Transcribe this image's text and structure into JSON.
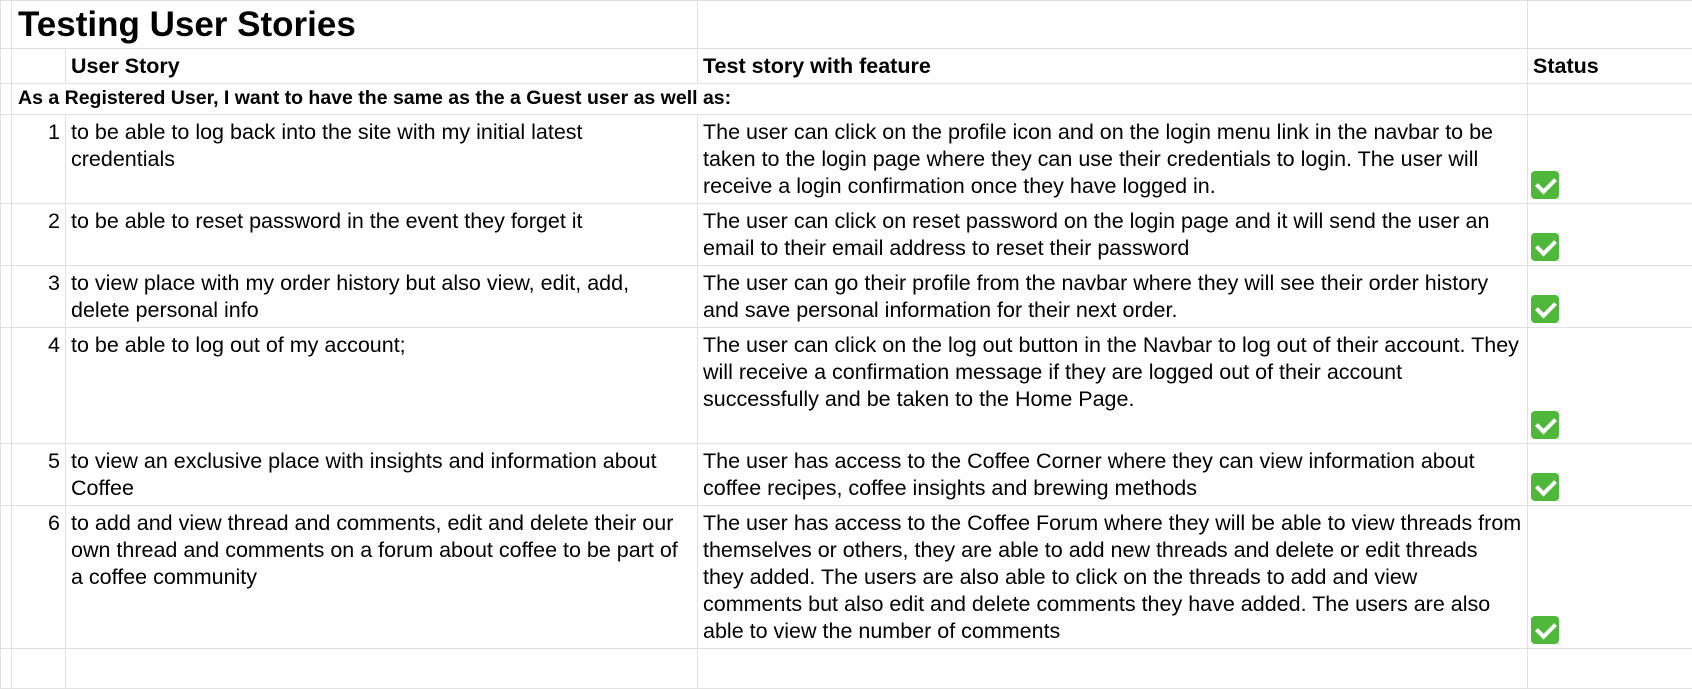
{
  "title": "Testing User Stories",
  "headers": {
    "story": "User Story",
    "test": "Test story with feature",
    "status": "Status"
  },
  "section_text": "As a Registered User, I want to have the same as the a Guest user as well as:",
  "rows": [
    {
      "num": "1",
      "story": "to be able to log back into the site with my initial latest credentials",
      "test": "The user can click on the profile icon and on the login menu link in the navbar to be taken to the login page where they can use their credentials to login. The user will receive a login confirmation once they have logged in.",
      "status_icon": "green-check-mark-icon"
    },
    {
      "num": "2",
      "story": "to be able to reset password in the event they forget it",
      "test": "The user can click on reset password on the login page and it will send the user an email to their email address to reset their password",
      "status_icon": "green-check-mark-icon"
    },
    {
      "num": "3",
      "story": "to view place with my order history but also view, edit, add, delete personal info",
      "test": "The user can go their profile from the navbar where they will see their order history and save personal information for their next order.",
      "status_icon": "green-check-mark-icon"
    },
    {
      "num": "4",
      "story": "to be able to log out of my account;",
      "test": "The user can click on the log out button in the Navbar to log out of their account. They will receive a confirmation message if they are logged out of their account successfully and be taken to the Home Page.",
      "status_icon": "green-check-mark-icon"
    },
    {
      "num": "5",
      "story": "to view an exclusive place with insights and information about Coffee",
      "test": "The user has access to the Coffee Corner where they can view information about coffee recipes, coffee insights and brewing methods",
      "status_icon": "green-check-mark-icon"
    },
    {
      "num": "6",
      "story": "to add and view thread and comments, edit and delete their our own thread and comments on a forum about coffee to be part of a coffee community",
      "test": "The user has access to the Coffee Forum where they will be able to view threads from themselves or others, they are able to add new threads and delete or edit threads they added. The users are also able to click on the threads to add and view comments but also edit and delete comments they have added. The users are also able to view the number of comments",
      "status_icon": "green-check-mark-icon"
    }
  ],
  "colors": {
    "gridline": "#e1e1e1",
    "check_green": "#4fb83a"
  }
}
